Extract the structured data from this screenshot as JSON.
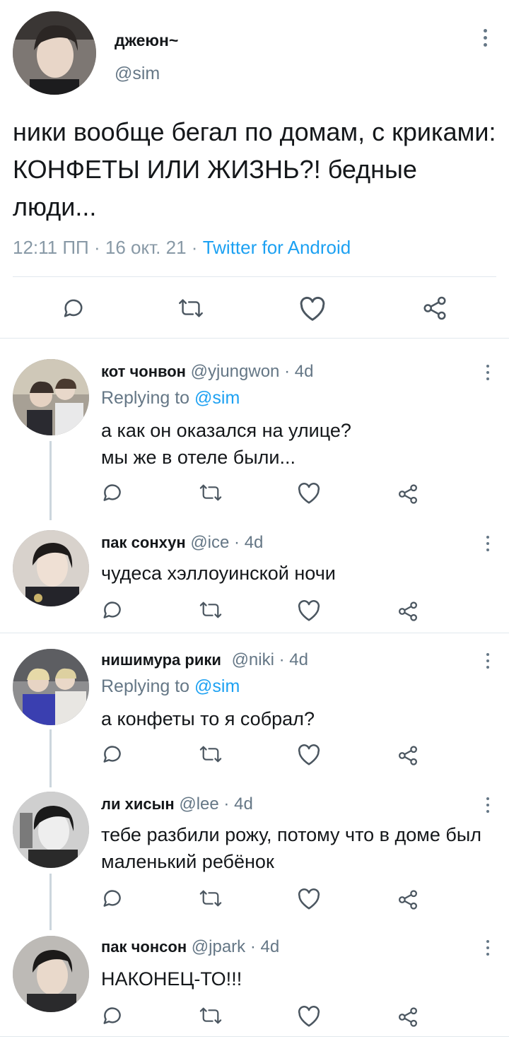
{
  "main_tweet": {
    "name": "джеюн~",
    "handle": "@sim",
    "text": "ники вообще бегал по домам, с криками: КОНФЕТЫ ИЛИ ЖИЗНЬ?! бедные люди...",
    "time": "12:11 ПП",
    "date": "16 окт. 21",
    "source": "Twitter for Android",
    "separator": "·"
  },
  "icons": {
    "reply": "comment-icon",
    "retweet": "retweet-icon",
    "like": "heart-icon",
    "share": "share-icon",
    "more": "more-vertical-icon"
  },
  "colors": {
    "link": "#1da1f2",
    "secondary_text": "#657786",
    "divider": "#e1e8ed",
    "thread_line": "#ccd6dd"
  },
  "replies": [
    {
      "name": "кот чонвон",
      "handle": "@yjungwon",
      "age": "4d",
      "replying_prefix": "Replying to",
      "replying_to": "@sim",
      "text": "а как он оказался на улице?\nмы же в отеле были..."
    },
    {
      "name": "пак сонхун",
      "handle": "@ice",
      "age": "4d",
      "text": "чудеса хэллоуинской ночи"
    },
    {
      "name": "нишимура рики",
      "handle": "@niki",
      "age": "4d",
      "replying_prefix": "Replying to",
      "replying_to": "@sim",
      "text": "а конфеты то я собрал?"
    },
    {
      "name": "ли хисын",
      "handle": "@lee",
      "age": "4d",
      "text": "тебе разбили рожу, потому что в доме был маленький ребёнок"
    },
    {
      "name": "пак чонсон",
      "handle": "@jpark",
      "age": "4d",
      "text": "НАКОНЕЦ-ТО!!!"
    }
  ]
}
